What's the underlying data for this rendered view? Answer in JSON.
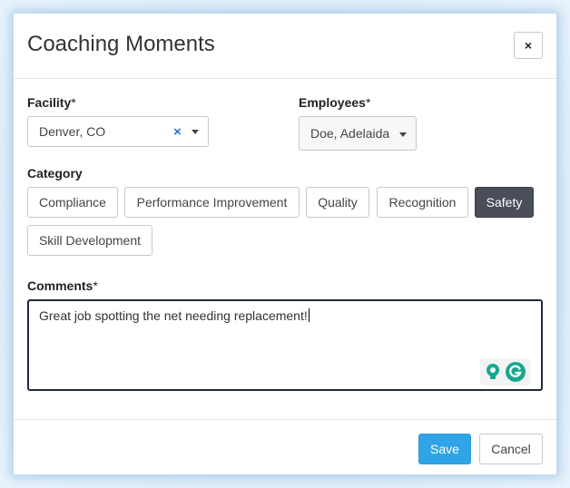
{
  "dialog": {
    "title": "Coaching Moments",
    "close_label": "×"
  },
  "facility": {
    "label": "Facility",
    "required_mark": "*",
    "value": "Denver, CO",
    "clear_icon": "×"
  },
  "employees": {
    "label": "Employees",
    "required_mark": "*",
    "value": "Doe, Adelaida"
  },
  "category": {
    "label": "Category",
    "options": [
      "Compliance",
      "Performance Improvement",
      "Quality",
      "Recognition",
      "Safety",
      "Skill Development"
    ],
    "selected": "Safety"
  },
  "comments": {
    "label": "Comments",
    "required_mark": "*",
    "value": "Great job spotting the net needing replacement!"
  },
  "footer": {
    "save_label": "Save",
    "cancel_label": "Cancel"
  },
  "colors": {
    "primary": "#2fa4e7",
    "selected_category": "#4a4e58",
    "clear_icon": "#2f74c0",
    "grammarly_green": "#15a88d"
  },
  "icons": {
    "close": "close-icon",
    "clear": "clear-icon",
    "caret": "caret-down-icon",
    "grammarly": "grammarly-icon",
    "lightbulb": "lightbulb-icon"
  }
}
